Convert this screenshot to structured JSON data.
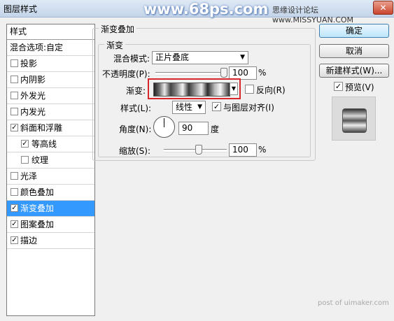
{
  "window": {
    "title": "图层样式",
    "watermark": "www.68ps.com",
    "watermark_site": "思缘设计论坛 www.MISSYUAN.COM",
    "close_label": "✕"
  },
  "styles_panel": {
    "header": "样式",
    "blend_options": "混合选项:自定",
    "items": [
      {
        "label": "投影",
        "checked": false
      },
      {
        "label": "内阴影",
        "checked": false
      },
      {
        "label": "外发光",
        "checked": false
      },
      {
        "label": "内发光",
        "checked": false
      },
      {
        "label": "斜面和浮雕",
        "checked": true
      },
      {
        "label": "等高线",
        "checked": true,
        "sub": true
      },
      {
        "label": "纹理",
        "checked": false,
        "sub": true
      },
      {
        "label": "光泽",
        "checked": false
      },
      {
        "label": "颜色叠加",
        "checked": false
      },
      {
        "label": "渐变叠加",
        "checked": true,
        "selected": true
      },
      {
        "label": "图案叠加",
        "checked": true
      },
      {
        "label": "描边",
        "checked": true
      }
    ]
  },
  "gradient_overlay": {
    "section_title": "渐变叠加",
    "group_title": "渐变",
    "blend_mode_label": "混合模式:",
    "blend_mode_value": "正片叠底",
    "opacity_label": "不透明度(P):",
    "opacity_value": "100",
    "opacity_level": 1.0,
    "percent": "%",
    "gradient_label": "渐变:",
    "reverse_label": "反向(R)",
    "reverse_checked": false,
    "style_label": "样式(L):",
    "style_value": "线性",
    "align_label": "与图层对齐(I)",
    "align_checked": true,
    "angle_label": "角度(N):",
    "angle_value": "90",
    "angle_unit": "度",
    "scale_label": "缩放(S):",
    "scale_value": "100",
    "scale_level": 0.5
  },
  "buttons": {
    "ok": "确定",
    "cancel": "取消",
    "new_style": "新建样式(W)...",
    "preview_label": "预览(V)",
    "preview_checked": true
  },
  "footer_watermark": "post of uimaker.com",
  "colors": {
    "selection": "#3399ff",
    "highlight_box": "#d9262b"
  }
}
